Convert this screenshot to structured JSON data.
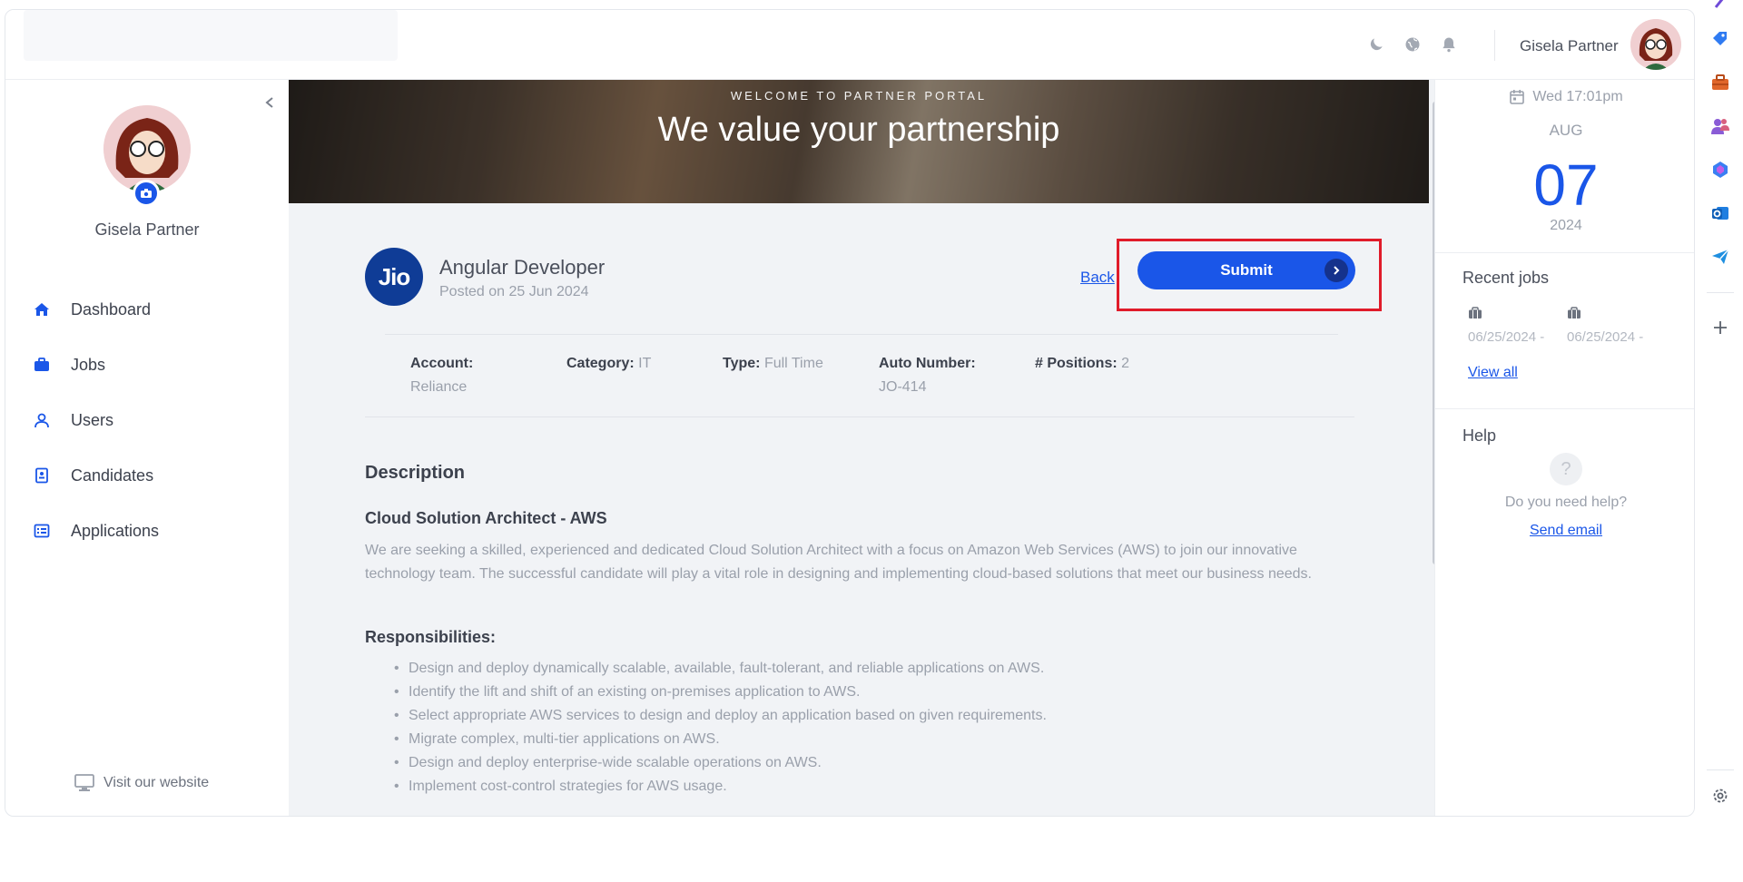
{
  "header": {
    "username": "Gisela Partner",
    "icons": [
      "moon-icon",
      "globe-icon",
      "bell-icon"
    ]
  },
  "sidebar": {
    "username": "Gisela Partner",
    "items": [
      {
        "label": "Dashboard",
        "icon": "home-icon"
      },
      {
        "label": "Jobs",
        "icon": "briefcase-icon"
      },
      {
        "label": "Users",
        "icon": "user-icon"
      },
      {
        "label": "Candidates",
        "icon": "contact-card-icon"
      },
      {
        "label": "Applications",
        "icon": "list-icon"
      }
    ],
    "visit_website": "Visit our website"
  },
  "banner": {
    "kicker": "WELCOME TO PARTNER PORTAL",
    "title": "We value your partnership"
  },
  "job": {
    "logo_text": "Jio",
    "title": "Angular Developer",
    "posted": "Posted on 25 Jun 2024",
    "back_label": "Back",
    "submit_label": "Submit",
    "meta": [
      {
        "key": "Account:",
        "value": "Reliance"
      },
      {
        "key": "Category:",
        "value": "IT"
      },
      {
        "key": "Type:",
        "value": "Full Time"
      },
      {
        "key": "Auto Number:",
        "value": "JO-414"
      },
      {
        "key": "# Positions:",
        "value": "2"
      }
    ],
    "description_heading": "Description",
    "subheading": "Cloud Solution Architect - AWS",
    "paragraph": "We are seeking a skilled, experienced and dedicated Cloud Solution Architect with a focus on Amazon Web Services (AWS) to join our innovative technology team. The successful candidate will play a vital role in designing and implementing cloud-based solutions that meet our business needs.",
    "responsibilities_heading": "Responsibilities:",
    "responsibilities": [
      "Design and deploy dynamically scalable, available, fault-tolerant, and reliable applications on AWS.",
      "Identify the lift and shift of an existing on-premises application to AWS.",
      "Select appropriate AWS services to design and deploy an application based on given requirements.",
      "Migrate complex, multi-tier applications on AWS.",
      "Design and deploy enterprise-wide scalable operations on AWS.",
      "Implement cost-control strategies for AWS usage."
    ]
  },
  "right_panel": {
    "datetime": "Wed 17:01pm",
    "month": "AUG",
    "day": "07",
    "year": "2024",
    "recent_heading": "Recent jobs",
    "recent_jobs": [
      {
        "date": "06/25/2024 -"
      },
      {
        "date": "06/25/2024 -"
      }
    ],
    "view_all": "View all",
    "help_heading": "Help",
    "help_symbol": "?",
    "help_question": "Do you need help?",
    "send_email": "Send email"
  },
  "colors": {
    "accent": "#1a56e8",
    "highlight_border": "#e01b2a",
    "background": "#f1f3f6"
  }
}
